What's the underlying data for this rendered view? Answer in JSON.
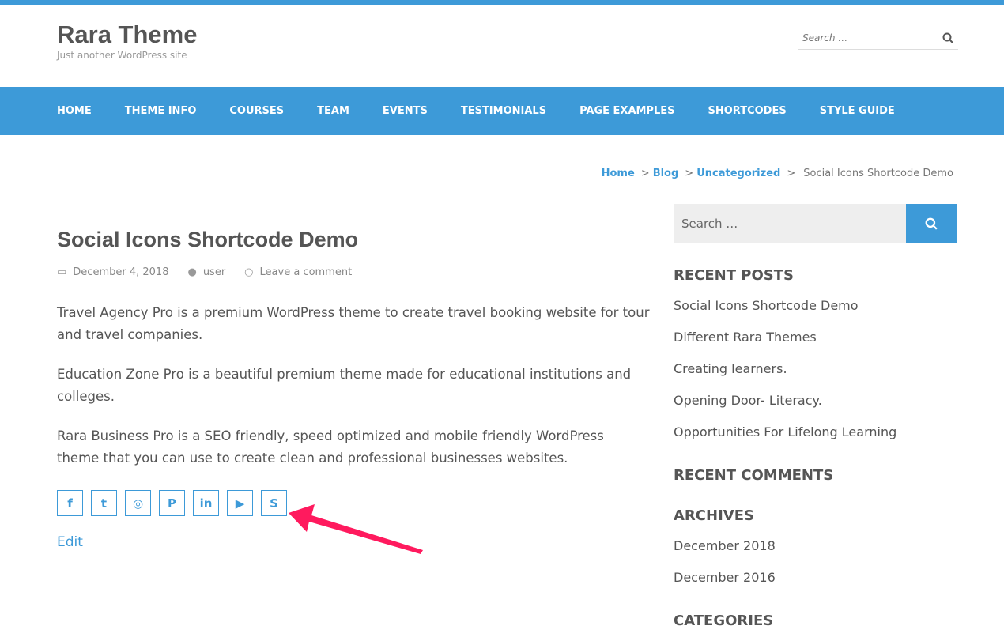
{
  "site": {
    "title": "Rara Theme",
    "tagline": "Just another WordPress site"
  },
  "header_search": {
    "placeholder": "Search …"
  },
  "nav": [
    "HOME",
    "THEME INFO",
    "COURSES",
    "TEAM",
    "EVENTS",
    "TESTIMONIALS",
    "PAGE EXAMPLES",
    "SHORTCODES",
    "STYLE GUIDE"
  ],
  "breadcrumb": {
    "items": [
      "Home",
      "Blog",
      "Uncategorized"
    ],
    "current": "Social Icons Shortcode Demo",
    "sep": ">"
  },
  "post": {
    "title": "Social Icons Shortcode Demo",
    "date": "December 4, 2018",
    "author": "user",
    "comments": "Leave a comment",
    "paragraphs": [
      "Travel Agency Pro is a premium WordPress theme to create travel booking website for tour and travel companies.",
      "Education Zone Pro is a beautiful premium theme made for educational institutions and colleges.",
      "Rara Business Pro is a SEO friendly, speed optimized and mobile friendly WordPress theme that you can use to create clean and professional businesses websites."
    ],
    "edit": "Edit"
  },
  "social": [
    {
      "name": "facebook",
      "glyph": "f"
    },
    {
      "name": "twitter",
      "glyph": "t"
    },
    {
      "name": "instagram",
      "glyph": "◎"
    },
    {
      "name": "pinterest",
      "glyph": "P"
    },
    {
      "name": "linkedin",
      "glyph": "in"
    },
    {
      "name": "youtube",
      "glyph": "▶"
    },
    {
      "name": "skype",
      "glyph": "S"
    }
  ],
  "sidebar": {
    "search_placeholder": "Search …",
    "recent_posts_title": "RECENT POSTS",
    "recent_posts": [
      "Social Icons Shortcode Demo",
      "Different Rara Themes",
      "Creating learners.",
      "Opening Door- Literacy.",
      "Opportunities For Lifelong Learning"
    ],
    "recent_comments_title": "RECENT COMMENTS",
    "archives_title": "ARCHIVES",
    "archives": [
      "December 2018",
      "December 2016"
    ],
    "categories_title": "CATEGORIES"
  },
  "colors": {
    "accent": "#3d9ad8",
    "arrow": "#ff1a5e"
  }
}
